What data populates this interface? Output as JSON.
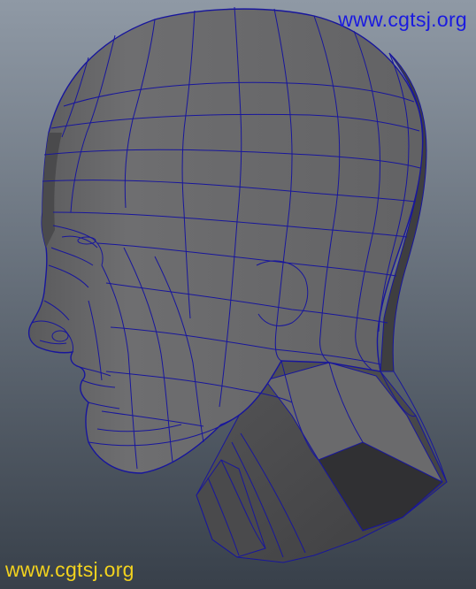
{
  "viewport": {
    "background_top": "#8f99a5",
    "background_bottom": "#38404a",
    "mesh_fill": "#6c6c6e",
    "mesh_fill_shadow": "#3b3b3d",
    "wire_color": "#18169c"
  },
  "watermarks": {
    "top": {
      "text": "www.cgtsj.org",
      "color": "#1a1ae0"
    },
    "bottom": {
      "text": "www.cgtsj.org",
      "color": "#f2d21e"
    }
  }
}
